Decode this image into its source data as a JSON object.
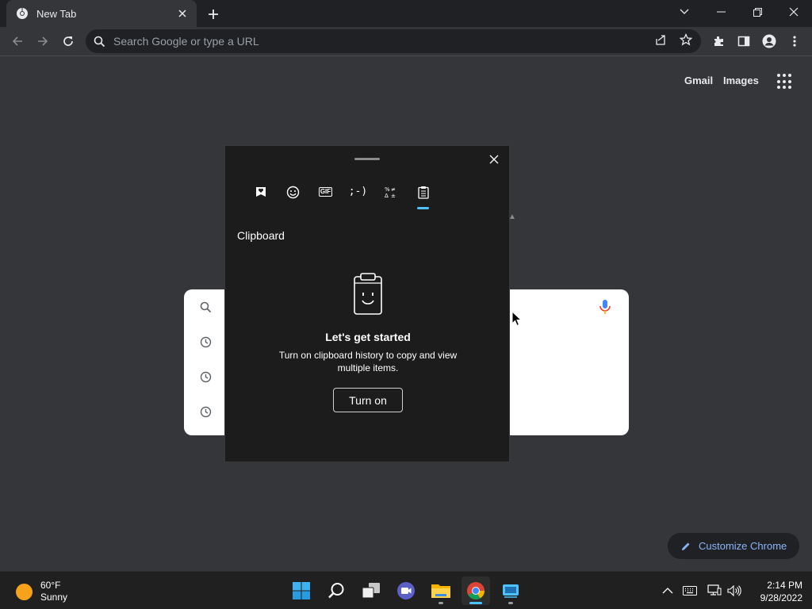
{
  "browser": {
    "tab_title": "New Tab",
    "omnibox_placeholder": "Search Google or type a URL"
  },
  "ntp": {
    "gmail_label": "Gmail",
    "images_label": "Images",
    "customize_label": "Customize Chrome"
  },
  "panel": {
    "tabs": [
      "favorites-icon",
      "emoji-icon",
      "gif-icon",
      "kaomoji-icon",
      "symbols-icon",
      "clipboard-icon"
    ],
    "gif_label": "GIF",
    "kaomoji_label": ";-)",
    "heading": "Clipboard",
    "title": "Let's get started",
    "description": "Turn on clipboard history to copy and view multiple items.",
    "button_label": "Turn on"
  },
  "taskbar": {
    "temperature": "60°F",
    "condition": "Sunny",
    "time": "2:14 PM",
    "date": "9/28/2022"
  },
  "colors": {
    "accent": "#4cc2ff",
    "link_blue": "#8ab4f8",
    "weather_sun": "#f7a21b"
  }
}
